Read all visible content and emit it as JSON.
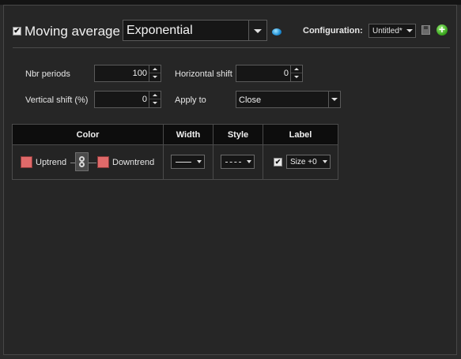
{
  "header": {
    "indicator_enabled": true,
    "check_glyph": "✔",
    "title": "Moving average",
    "type_value": "Exponential",
    "info_icon": "info-dot-icon",
    "config_label": "Configuration:",
    "config_value": "Untitled*",
    "save_icon": "save-icon",
    "add_icon": "add-icon",
    "add_glyph": "+"
  },
  "params": {
    "nbr_periods": {
      "label": "Nbr periods",
      "value": "100"
    },
    "horizontal_shift": {
      "label": "Horizontal shift",
      "value": "0"
    },
    "vertical_shift": {
      "label": "Vertical shift (%)",
      "value": "0"
    },
    "apply_to": {
      "label": "Apply to",
      "value": "Close"
    }
  },
  "style_table": {
    "headers": [
      "Color",
      "Width",
      "Style",
      "Label"
    ],
    "uptrend_label": "Uptrend",
    "downtrend_label": "Downtrend",
    "uptrend_color": "#e06a6a",
    "downtrend_color": "#e06a6a",
    "width_value": "solid",
    "style_value": "dotted",
    "label_checked": true,
    "label_size": "Size +0"
  }
}
